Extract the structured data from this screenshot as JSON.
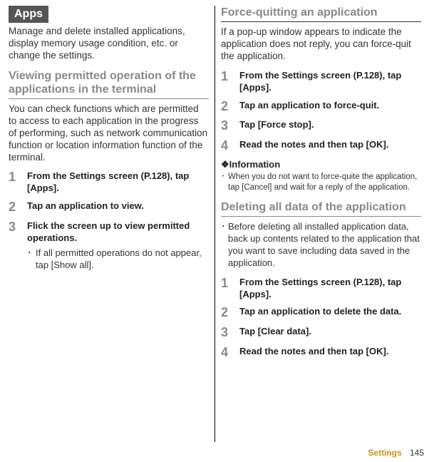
{
  "left": {
    "apps_header": "Apps",
    "apps_intro": "Manage and delete installed applications, display memory usage condition, etc. or change the settings.",
    "section1_title": "Viewing permitted operation of the applications in the terminal",
    "section1_intro": "You can check functions which are permitted to access to each application in the progress of performing, such as network communication function or location information function of the terminal.",
    "step1_num": "1",
    "step1_text": "From the Settings screen (P.128), tap [Apps].",
    "step2_num": "2",
    "step2_text": "Tap an application to view.",
    "step3_num": "3",
    "step3_text": "Flick the screen up to view permitted operations.",
    "step3_sub": "If all permitted operations do not appear, tap [Show all]."
  },
  "right": {
    "section_a_title": "Force-quitting an application",
    "section_a_intro": "If a pop-up window appears to indicate the application does not reply, you can force-quit the application.",
    "a_step1_num": "1",
    "a_step1_text": "From the Settings screen (P.128), tap [Apps].",
    "a_step2_num": "2",
    "a_step2_text": "Tap an application to force-quit.",
    "a_step3_num": "3",
    "a_step3_text": "Tap [Force stop].",
    "a_step4_num": "4",
    "a_step4_text": "Read the notes and then tap [OK].",
    "info_head": "❖Information",
    "info_item": "When you do not want to force-quite the application, tap [Cancel] and wait for a reply of the application.",
    "section_b_title": "Deleting all data of the application",
    "section_b_pre": "Before deleting all installed application data, back up contents related to the application that you want to save including data saved in the application.",
    "b_step1_num": "1",
    "b_step1_text": "From the Settings screen (P.128), tap [Apps].",
    "b_step2_num": "2",
    "b_step2_text": "Tap an application to delete the data.",
    "b_step3_num": "3",
    "b_step3_text": "Tap [Clear data].",
    "b_step4_num": "4",
    "b_step4_text": "Read the notes and then tap [OK]."
  },
  "footer": {
    "label": "Settings",
    "page": "145"
  }
}
